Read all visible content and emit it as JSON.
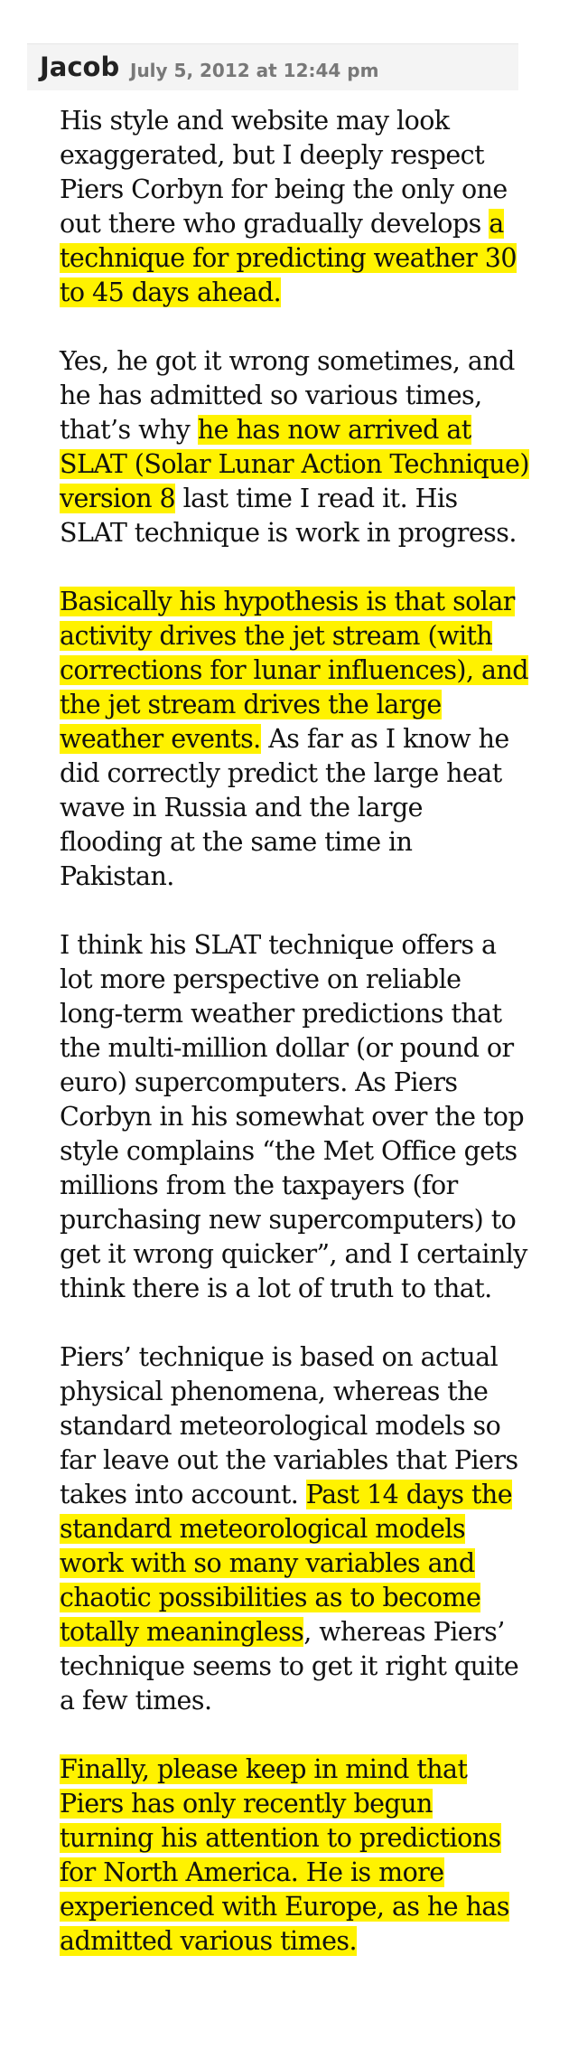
{
  "comment": {
    "author": "Jacob",
    "date": "July 5, 2012 at 12:44 pm",
    "highlight_color": "#fff200",
    "paragraphs": [
      [
        {
          "text": "His style and website may look exaggerated, but I deeply respect Piers Corbyn for being the only one out there who gradually develops ",
          "highlight": false
        },
        {
          "text": "a technique for predicting weather 30 to 45 days ahead.",
          "highlight": true
        }
      ],
      [
        {
          "text": "Yes, he got it wrong sometimes, and he has admitted so various times, that’s why ",
          "highlight": false
        },
        {
          "text": "he has now arrived at SLAT (Solar Lunar Action Technique) version 8",
          "highlight": true
        },
        {
          "text": " last time I read it. His SLAT technique is work in progress.",
          "highlight": false
        }
      ],
      [
        {
          "text": "Basically his hypothesis is that solar activity drives the jet stream (with corrections for lunar influences), and the jet stream drives the large weather events.",
          "highlight": true
        },
        {
          "text": " As far as I know he did correctly predict the large heat wave in Russia and the large flooding at the same time in Pakistan.",
          "highlight": false
        }
      ],
      [
        {
          "text": "I think his SLAT technique offers a lot more perspective on reliable long-term weather predictions that the multi-million dollar (or pound or euro) supercomputers. As Piers Corbyn in his somewhat over the top style complains “the Met Office gets millions from the taxpayers (for purchasing new supercomputers) to get it wrong quicker”, and I certainly think there is a lot of truth to that.",
          "highlight": false
        }
      ],
      [
        {
          "text": "Piers’ technique is based on actual physical phenomena, whereas the standard meteorological models so far leave out the variables that Piers takes into account. ",
          "highlight": false
        },
        {
          "text": "Past 14 days the standard meteorological models work with so many variables and chaotic possibilities as to become totally meaningless",
          "highlight": true
        },
        {
          "text": ", whereas Piers’ technique seems to get it right quite a few times.",
          "highlight": false
        }
      ],
      [
        {
          "text": "Finally, please keep in mind that Piers has only recently begun turning his attention to predictions for North America. He is more experienced with Europe, as he has admitted various times.",
          "highlight": true
        }
      ]
    ]
  }
}
